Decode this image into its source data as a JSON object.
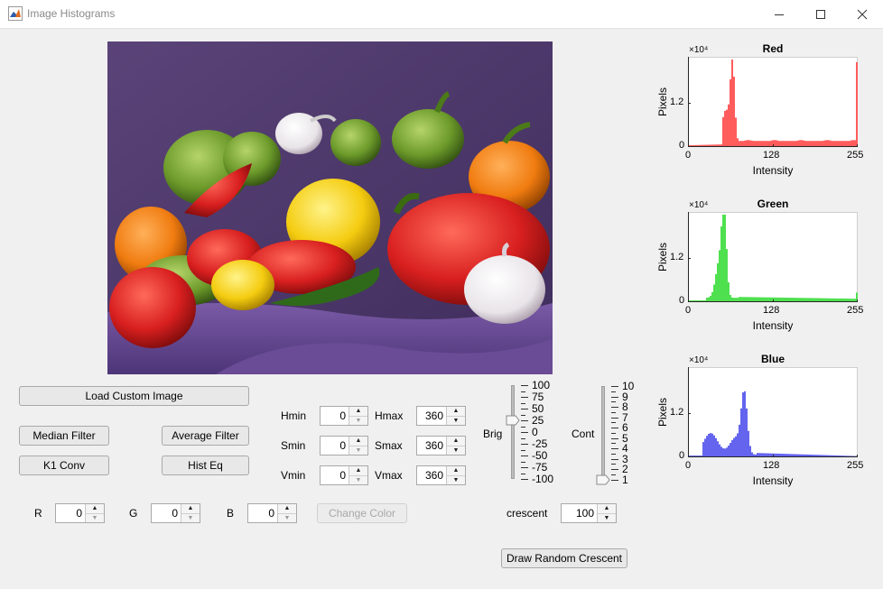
{
  "window": {
    "title": "Image Histograms",
    "app_icon": "matlab-icon",
    "controls": {
      "minimize": "minimize-icon",
      "maximize": "maximize-icon",
      "close": "close-icon"
    }
  },
  "image": {
    "description_icon": "image-canvas"
  },
  "buttons": {
    "load": "Load Custom Image",
    "median": "Median Filter",
    "average": "Average Filter",
    "k1conv": "K1 Conv",
    "histeq": "Hist Eq",
    "change_color": "Change Color",
    "draw_crescent": "Draw Random Crescent"
  },
  "hsv": {
    "hmin": {
      "label": "Hmin",
      "value": "0"
    },
    "hmax": {
      "label": "Hmax",
      "value": "360"
    },
    "smin": {
      "label": "Smin",
      "value": "0"
    },
    "smax": {
      "label": "Smax",
      "value": "360"
    },
    "vmin": {
      "label": "Vmin",
      "value": "0"
    },
    "vmax": {
      "label": "Vmax",
      "value": "360"
    }
  },
  "rgb": {
    "r": {
      "label": "R",
      "value": "0"
    },
    "g": {
      "label": "G",
      "value": "0"
    },
    "b": {
      "label": "B",
      "value": "0"
    }
  },
  "crescent": {
    "label": "crescent",
    "value": "100"
  },
  "brig": {
    "label": "Brig",
    "ticks": [
      "100",
      "75",
      "50",
      "25",
      "0",
      "-25",
      "-50",
      "-75",
      "-100"
    ],
    "value": 0
  },
  "cont": {
    "label": "Cont",
    "ticks": [
      "10",
      "9",
      "8",
      "7",
      "6",
      "5",
      "4",
      "3",
      "2",
      "1"
    ],
    "value": 1
  },
  "histograms": [
    {
      "title": "Red",
      "ylabel": "Pixels",
      "xlabel": "Intensity",
      "exponent": "×10⁴",
      "yticks": [
        "1.2",
        "0"
      ],
      "xticks": [
        "0",
        "128",
        "255"
      ],
      "color": "#ff5c5c"
    },
    {
      "title": "Green",
      "ylabel": "Pixels",
      "xlabel": "Intensity",
      "exponent": "×10⁴",
      "yticks": [
        "1.2",
        "0"
      ],
      "xticks": [
        "0",
        "128",
        "255"
      ],
      "color": "#4fe04f"
    },
    {
      "title": "Blue",
      "ylabel": "Pixels",
      "xlabel": "Intensity",
      "exponent": "×10⁴",
      "yticks": [
        "1.2",
        "0"
      ],
      "xticks": [
        "0",
        "128",
        "255"
      ],
      "color": "#6464ee"
    }
  ]
}
